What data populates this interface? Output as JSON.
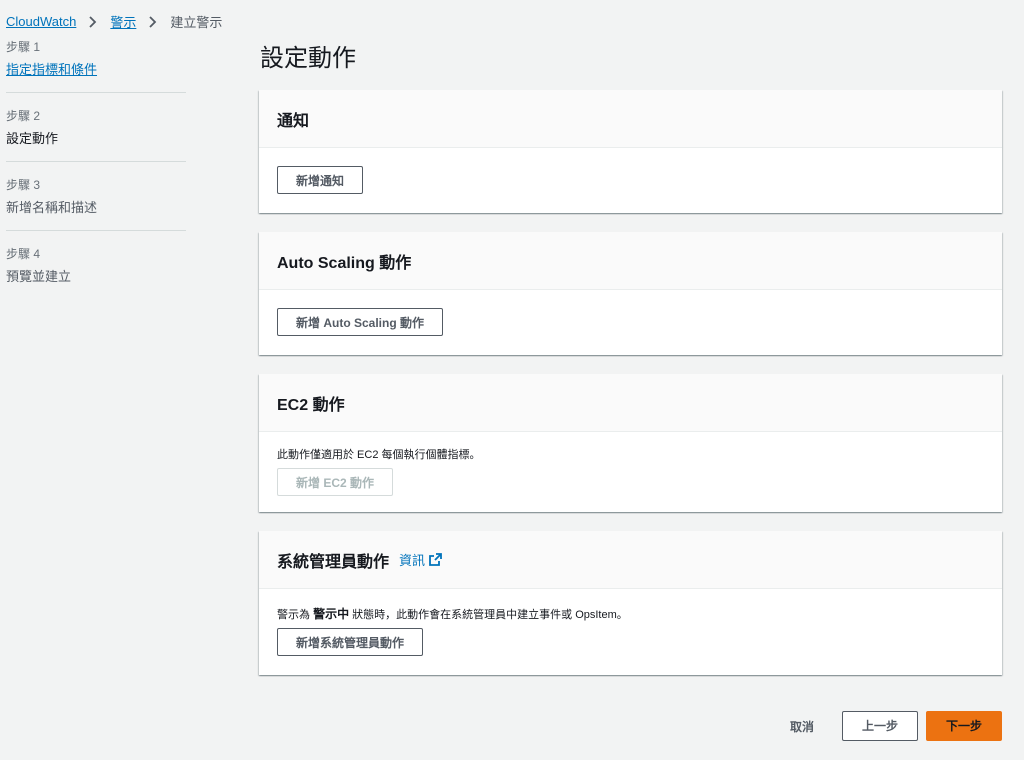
{
  "breadcrumb": {
    "items": [
      "CloudWatch",
      "警示",
      "建立警示"
    ]
  },
  "steps": [
    {
      "num": "步驟 1",
      "title": "指定指標和條件"
    },
    {
      "num": "步驟 2",
      "title": "設定動作"
    },
    {
      "num": "步驟 3",
      "title": "新增名稱和描述"
    },
    {
      "num": "步驟 4",
      "title": "預覽並建立"
    }
  ],
  "page_title": "設定動作",
  "panels": {
    "notification": {
      "header": "通知",
      "button": "新增通知"
    },
    "autoscaling": {
      "header": "Auto Scaling 動作",
      "button": "新增 Auto Scaling 動作"
    },
    "ec2": {
      "header": "EC2 動作",
      "desc": "此動作僅適用於 EC2 每個執行個體指標。",
      "button": "新增 EC2 動作"
    },
    "ssm": {
      "header": "系統管理員動作",
      "info": "資訊",
      "desc_pre": "警示為 ",
      "desc_bold": "警示中",
      "desc_post": " 狀態時，此動作會在系統管理員中建立事件或 OpsItem。",
      "button": "新增系統管理員動作"
    }
  },
  "footer": {
    "cancel": "取消",
    "prev": "上一步",
    "next": "下一步"
  },
  "colors": {
    "accent": "#ec7211",
    "link": "#0073bb",
    "background": "#f2f3f3"
  }
}
